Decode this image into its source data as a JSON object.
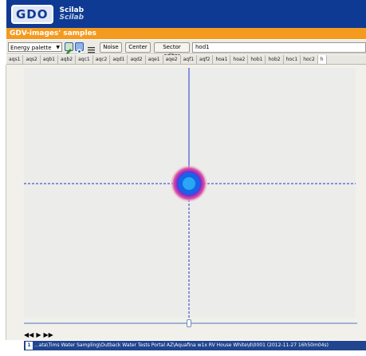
{
  "header": {
    "logo_text": "GDO",
    "brand_line1": "Scilab",
    "brand_line2": "Scilab"
  },
  "title": "GDV-images' samples",
  "toolbar": {
    "palette_value": "Energy palette",
    "noise_label": "Noise",
    "center_label": "Center",
    "sector_editor_label": "Sector editor",
    "name_value": "hod1",
    "icons": [
      "edit-icon",
      "image-icon",
      "list-icon"
    ]
  },
  "tabs": [
    "aqs1",
    "aqs2",
    "aqb1",
    "aqb2",
    "aqc1",
    "aqc2",
    "aqd1",
    "aqd2",
    "aqe1",
    "aqe2",
    "aqf1",
    "aqf2",
    "hoa1",
    "hoa2",
    "hob1",
    "hob2",
    "hoc1",
    "hoc2",
    "h"
  ],
  "active_tab": "h",
  "nav": {
    "first": "◀◀",
    "play": "▶",
    "last": "▶▶"
  },
  "status": {
    "index": "1",
    "path": "...ata\\Tims Water Sampling\\Outback Water Tests Portal AZ\\Aquafina w1x RV House White\\d\\0001 (2012-11-27 16h50m04s)"
  },
  "colors": {
    "header_bg": "#0f3a93",
    "title_bar": "#f39a1f",
    "status_bg": "#21458f",
    "crosshair": "#1f35c4"
  }
}
